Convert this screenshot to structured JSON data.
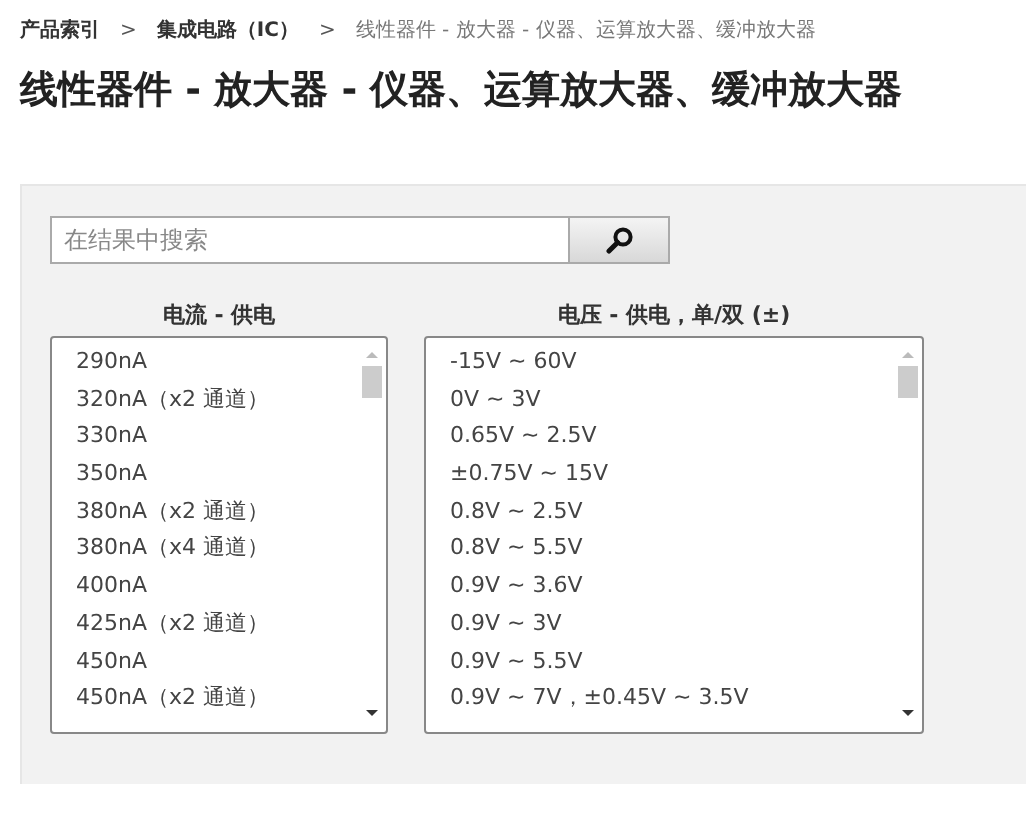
{
  "breadcrumb": [
    {
      "label": "产品索引",
      "kind": "link"
    },
    {
      "label": ">",
      "kind": "separator"
    },
    {
      "label": "集成电路（IC）",
      "kind": "link"
    },
    {
      "label": ">",
      "kind": "separator"
    },
    {
      "label": "线性器件 - 放大器 - 仪器、运算放大器、缓冲放大器",
      "kind": "current"
    }
  ],
  "title": "线性器件 - 放大器 - 仪器、运算放大器、缓冲放大器",
  "search": {
    "placeholder": "在结果中搜索"
  },
  "filters": [
    {
      "heading": "电流 - 供电",
      "items": [
        "290nA",
        "320nA（x2 通道）",
        "330nA",
        "350nA",
        "380nA（x2 通道）",
        "380nA（x4 通道）",
        "400nA",
        "425nA（x2 通道）",
        "450nA",
        "450nA（x2 通道）"
      ]
    },
    {
      "heading": "电压 - 供电，单/双 (±)",
      "items": [
        "-15V ~ 60V",
        "0V ~ 3V",
        "0.65V ~ 2.5V",
        "±0.75V ~ 15V",
        "0.8V ~ 2.5V",
        "0.8V ~ 5.5V",
        "0.9V ~ 3.6V",
        "0.9V ~ 3V",
        "0.9V ~ 5.5V",
        "0.9V ~ 7V，±0.45V ~ 3.5V"
      ]
    }
  ]
}
